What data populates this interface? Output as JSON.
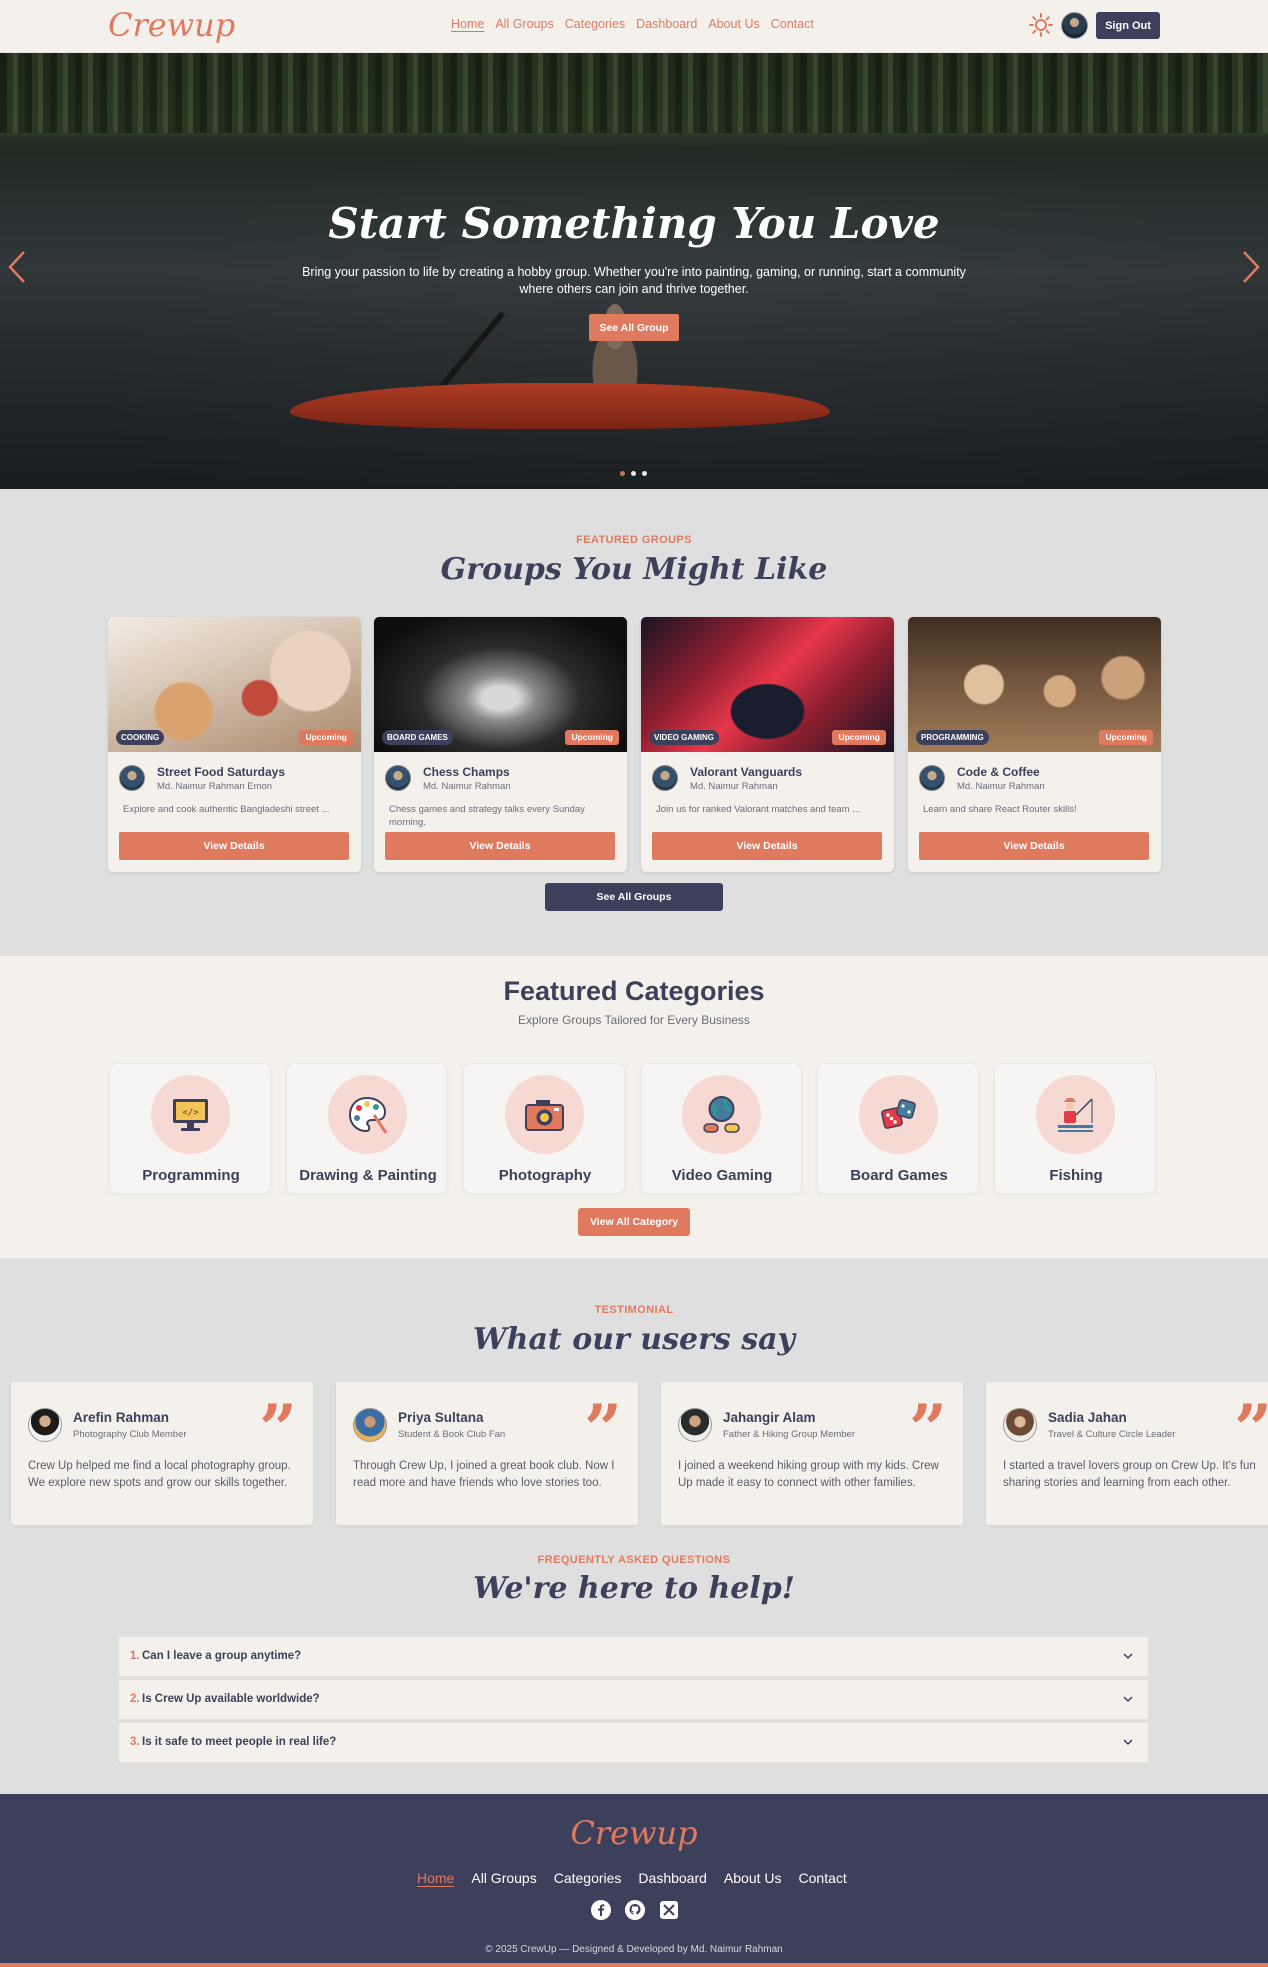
{
  "nav": {
    "logo": "Crewup",
    "links": [
      "Home",
      "All Groups",
      "Categories",
      "Dashboard",
      "About Us",
      "Contact"
    ],
    "active_link": "Home",
    "sign_out": "Sign Out"
  },
  "hero": {
    "title": "Start Something You Love",
    "subtitle": "Bring your passion to life by creating a hobby group. Whether you're into painting, gaming, or running, start a community where others can join and thrive together.",
    "cta": "See All Group",
    "slides": 3,
    "active_slide": 0
  },
  "groups": {
    "eyebrow": "FEATURED GROUPS",
    "title": "Groups You Might Like",
    "cards": [
      {
        "category": "COOKING",
        "status": "Upcoming",
        "title": "Street Food Saturdays",
        "organizer": "Md. Naimur Rahman Emon",
        "description": "Explore and cook authentic Bangladeshi street ...",
        "button": "View Details"
      },
      {
        "category": "BOARD GAMES",
        "status": "Upcoming",
        "title": "Chess Champs",
        "organizer": "Md. Naimur Rahman",
        "description": "Chess games and strategy talks every Sunday morning.",
        "button": "View Details"
      },
      {
        "category": "VIDEO GAMING",
        "status": "Upcoming",
        "title": "Valorant Vanguards",
        "organizer": "Md. Naimur Rahman",
        "description": "Join us for ranked Valorant matches and team ...",
        "button": "View Details"
      },
      {
        "category": "PROGRAMMING",
        "status": "Upcoming",
        "title": "Code & Coffee",
        "organizer": "Md. Naimur Rahman",
        "description": "Learn and share React Router skills!",
        "button": "View Details"
      }
    ],
    "see_all": "See All Groups"
  },
  "categories": {
    "title": "Featured Categories",
    "subtitle": "Explore Groups Tailored for Every Business",
    "items": [
      {
        "label": "Programming",
        "icon": "computer-code-icon"
      },
      {
        "label": "Drawing & Painting",
        "icon": "palette-icon"
      },
      {
        "label": "Photography",
        "icon": "camera-icon"
      },
      {
        "label": "Video Gaming",
        "icon": "globe-gamepad-icon"
      },
      {
        "label": "Board Games",
        "icon": "dice-icon"
      },
      {
        "label": "Fishing",
        "icon": "fisherman-icon"
      }
    ],
    "view_all": "View All Category"
  },
  "testimonials": {
    "eyebrow": "TESTIMONIAL",
    "title": "What our users say",
    "items": [
      {
        "name": "Arefin Rahman",
        "role": "Photography Club Member",
        "text": "Crew Up helped me find a local photography group. We explore new spots and grow our skills together."
      },
      {
        "name": "Priya Sultana",
        "role": "Student & Book Club Fan",
        "text": "Through Crew Up, I joined a great book club. Now I read more and have friends who love stories too."
      },
      {
        "name": "Jahangir Alam",
        "role": "Father & Hiking Group Member",
        "text": "I joined a weekend hiking group with my kids. Crew Up made it easy to connect with other families."
      },
      {
        "name": "Sadia Jahan",
        "role": "Travel & Culture Circle Leader",
        "text": "I started a travel lovers group on Crew Up. It's fun sharing stories and learning from each other."
      }
    ]
  },
  "faq": {
    "eyebrow": "FREQUENTLY ASKED QUESTIONS",
    "title": "We're here to help!",
    "items": [
      {
        "num": "1.",
        "question": "Can I leave a group anytime?"
      },
      {
        "num": "2.",
        "question": "Is Crew Up available worldwide?"
      },
      {
        "num": "3.",
        "question": "Is it safe to meet people in real life?"
      }
    ]
  },
  "footer": {
    "logo": "Crewup",
    "links": [
      "Home",
      "All Groups",
      "Categories",
      "Dashboard",
      "About Us",
      "Contact"
    ],
    "copyright": "© 2025 CrewUp — Designed & Developed by Md. Naimur Rahman"
  },
  "colors": {
    "accent": "#e07a5f",
    "navy": "#3d405b",
    "cream": "#f4f1ed",
    "gray_bg": "#e0dfe0"
  }
}
